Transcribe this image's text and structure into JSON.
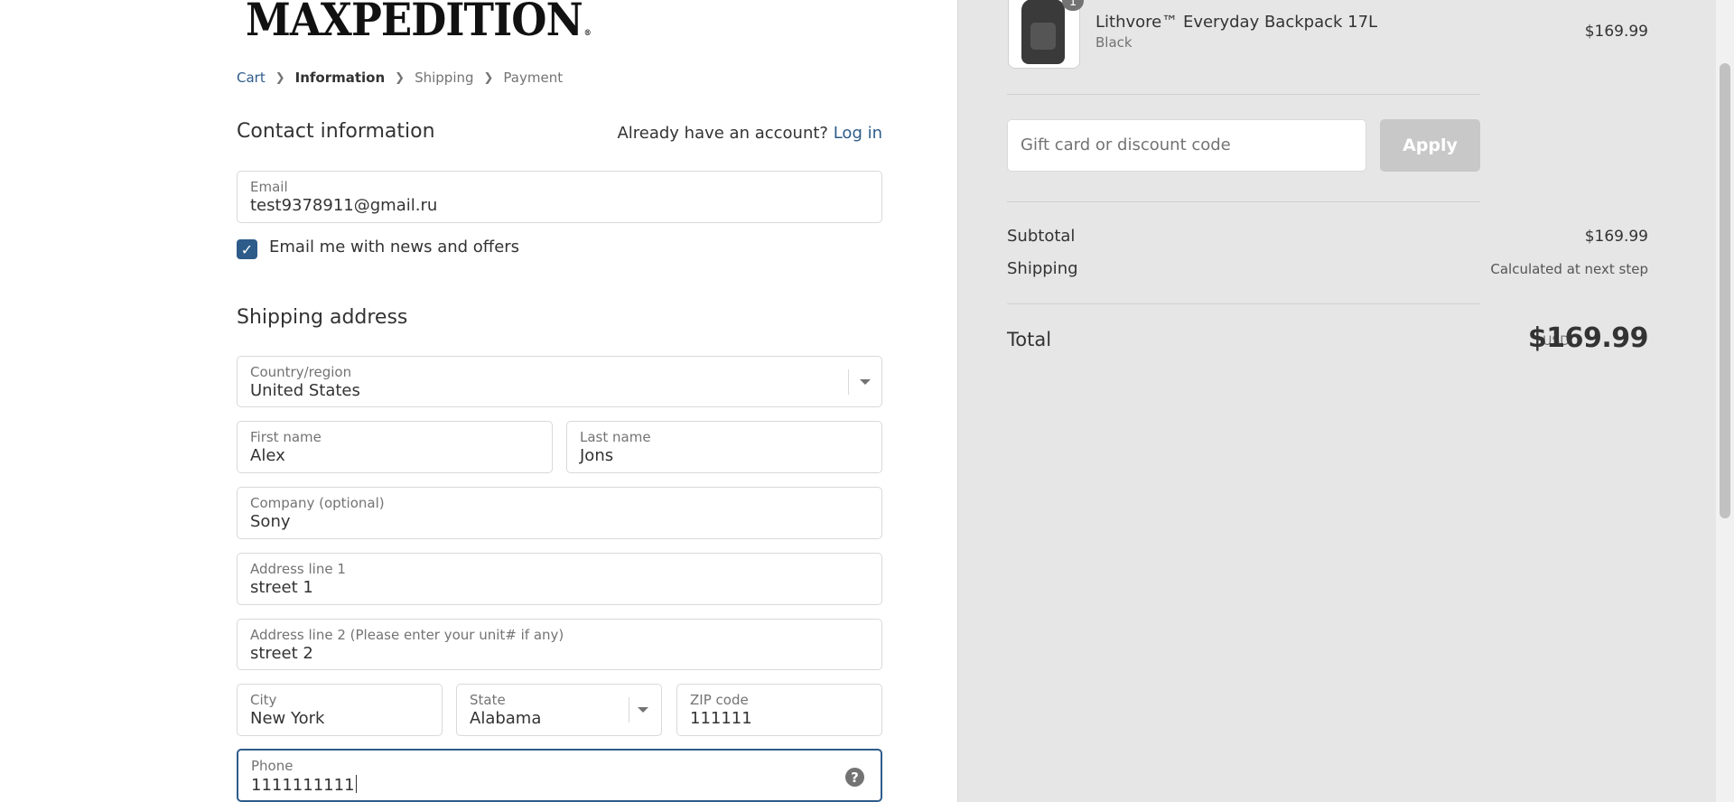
{
  "brand": {
    "logo_text": "MAXPEDITION",
    "reg_mark": "®"
  },
  "breadcrumb": {
    "cart": "Cart",
    "information": "Information",
    "shipping": "Shipping",
    "payment": "Payment"
  },
  "contact": {
    "title": "Contact information",
    "account_prompt": "Already have an account?",
    "login_label": "Log in",
    "email_label": "Email",
    "email_value": "test9378911@gmail.ru",
    "newsletter_label": "Email me with news and offers",
    "newsletter_checked": true
  },
  "shipping": {
    "title": "Shipping address",
    "country_label": "Country/region",
    "country_value": "United States",
    "first_name_label": "First name",
    "first_name_value": "Alex",
    "last_name_label": "Last name",
    "last_name_value": "Jons",
    "company_label": "Company (optional)",
    "company_value": "Sony",
    "address1_label": "Address line 1",
    "address1_value": "street 1",
    "address2_label": "Address line 2 (Please enter your unit# if any)",
    "address2_value": "street 2",
    "city_label": "City",
    "city_value": "New York",
    "state_label": "State",
    "state_value": "Alabama",
    "zip_label": "ZIP code",
    "zip_value": "111111",
    "phone_label": "Phone",
    "phone_value": "1111111111"
  },
  "order_summary": {
    "product": {
      "name": "Lithvore™ Everyday Backpack 17L",
      "variant": "Black",
      "price": "$169.99",
      "quantity": "1"
    },
    "discount_placeholder": "Gift card or discount code",
    "apply_label": "Apply",
    "subtotal_label": "Subtotal",
    "subtotal_value": "$169.99",
    "shipping_label": "Shipping",
    "shipping_value": "Calculated at next step",
    "total_label": "Total",
    "currency": "USD",
    "total_value": "$169.99"
  },
  "colors": {
    "accent": "#2e5c8a",
    "sidebar_bg": "#e6e6e6",
    "apply_disabled": "#c8c8c8"
  },
  "icons": [
    "chevron-right-icon",
    "check-icon",
    "chevron-down-icon",
    "help-icon"
  ]
}
